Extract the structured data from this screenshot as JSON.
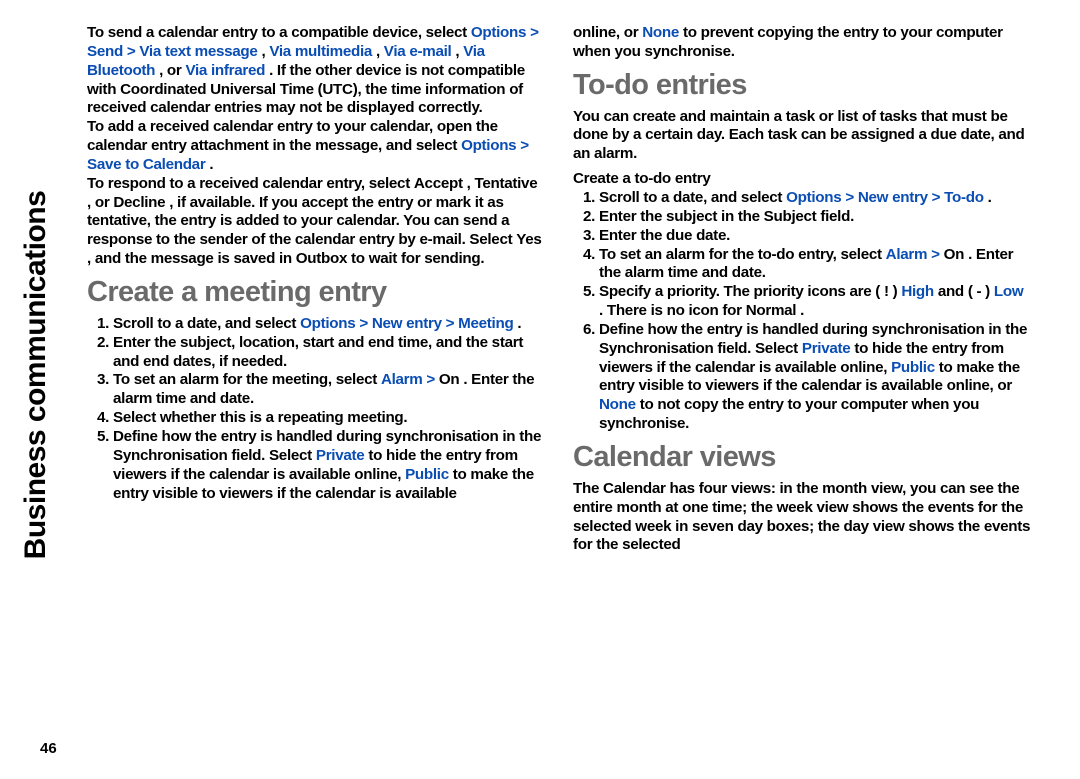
{
  "sideTab": "Business communications",
  "pageNumber": "46",
  "left": {
    "p1": {
      "a": "To send a calendar entry to a compatible device, select ",
      "opt": "Options",
      "gt1": " > ",
      "send": "Send",
      "gt2": " > ",
      "viatext": "Via text message",
      "c1": ", ",
      "viamm": "Via multimedia",
      "c2": ", ",
      "viaem": "Via e-mail",
      "c3": ", ",
      "viabt": "Via Bluetooth",
      "c4": ", or ",
      "viair": "Via infrared",
      "b": ". If the other device is not compatible with Coordinated Universal Time (UTC), the time information of received calendar entries may not be displayed correctly."
    },
    "p2": {
      "a": "To add a received calendar entry to your calendar, open the calendar entry attachment in the message, and select ",
      "opt": "Options",
      "gt": " > ",
      "save": "Save to Calendar",
      "dot": "."
    },
    "p3": {
      "a": "To respond to a received calendar entry, select ",
      "acc": "Accept",
      "c1": ", ",
      "tent": "Tentative",
      "c2": ", or ",
      "dec": "Decline",
      "b": ", if available. If you accept the entry or mark it as tentative, the entry is added to your calendar. You can send a response to the sender of the calendar entry by e-mail. Select ",
      "yes": "Yes",
      "c": ", and the message is saved in Outbox to wait for sending."
    },
    "h1": "Create a meeting entry",
    "li1": {
      "a": "Scroll to a date, and select ",
      "opt": "Options",
      "gt1": " > ",
      "new": "New entry",
      "gt2": " > ",
      "meet": "Meeting",
      "dot": "."
    },
    "li2": "Enter the subject, location, start and end time, and the start and end dates, if needed.",
    "li3": {
      "a": "To set an alarm for the meeting, select ",
      "alarm": "Alarm",
      "gt": " > ",
      "on": "On",
      "b": ". Enter the alarm time and date."
    },
    "li4": "Select whether this is a repeating meeting.",
    "li5": {
      "a": "Define how the entry is handled during synchronisation in the ",
      "sync": "Synchronisation",
      "b": " field. Select ",
      "priv": "Private",
      "c": " to hide the entry from viewers if the calendar is available online, ",
      "pub": "Public",
      "d": " to make the entry visible to viewers if the calendar is available"
    }
  },
  "right": {
    "cont": {
      "a": "online, or ",
      "none": "None",
      "b": " to prevent copying the entry to your computer when you synchronise."
    },
    "h_todo": "To-do entries",
    "todo_intro": "You can create and maintain a task or list of tasks that must be done by a certain day. Each task can be assigned a due date, and an alarm.",
    "subhead": "Create a to-do entry",
    "tli1": {
      "a": "Scroll to a date, and select ",
      "opt": "Options",
      "gt1": " > ",
      "new": "New entry",
      "gt2": " > ",
      "todo": "To-do",
      "dot": "."
    },
    "tli2": {
      "a": "Enter the subject in the ",
      "subj": "Subject",
      "b": " field."
    },
    "tli3": "Enter the due date.",
    "tli4": {
      "a": "To set an alarm for the to-do entry, select ",
      "alarm": "Alarm",
      "gt": " > ",
      "on": "On",
      "b": ". Enter the alarm time and date."
    },
    "tli5": {
      "a": "Specify a priority. The priority icons are ( ! ) ",
      "high": "High",
      "b": " and ( - ) ",
      "low": "Low",
      "c": ". There is no icon for ",
      "norm": "Normal",
      "dot": "."
    },
    "tli6": {
      "a": "Define how the entry is handled during synchronisation in the ",
      "sync": "Synchronisation",
      "b": " field. Select ",
      "priv": "Private",
      "c": " to hide the entry from viewers if the calendar is available online, ",
      "pub": "Public",
      "d": " to make the entry visible to viewers if the calendar is available online, or ",
      "none": "None",
      "e": " to not copy the entry to your computer when you synchronise."
    },
    "h_cal": "Calendar views",
    "cal_p": "The Calendar has four views: in the month view, you can see the entire month at one time; the week view shows the events for the selected week in seven day boxes; the day view shows the events for the selected"
  }
}
